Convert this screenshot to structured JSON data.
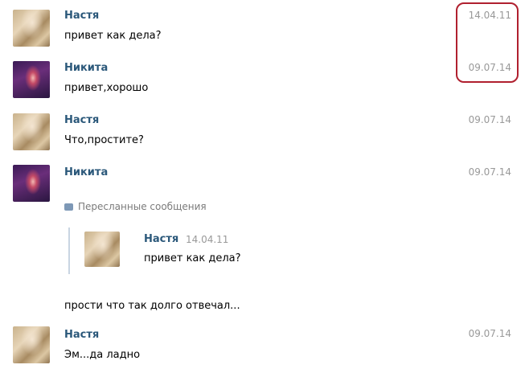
{
  "messages": [
    {
      "author": "Настя",
      "text": "привет как дела?",
      "date": "14.04.11"
    },
    {
      "author": "Никита",
      "text": "привет,хорошо",
      "date": "09.07.14"
    },
    {
      "author": "Настя",
      "text": "Что,простите?",
      "date": "09.07.14"
    },
    {
      "author": "Никита",
      "text": "",
      "date": "09.07.14"
    },
    {
      "author": "Настя",
      "text": "Эм...да ладно",
      "date": "09.07.14"
    }
  ],
  "forwarded": {
    "label": "Пересланные сообщения",
    "author": "Настя",
    "date": "14.04.11",
    "text": "привет как дела?"
  },
  "reply_text": "прости что так долго отвечал...",
  "colors": {
    "name": "#2b587a",
    "date": "#999999",
    "highlight": "#b0202f"
  }
}
